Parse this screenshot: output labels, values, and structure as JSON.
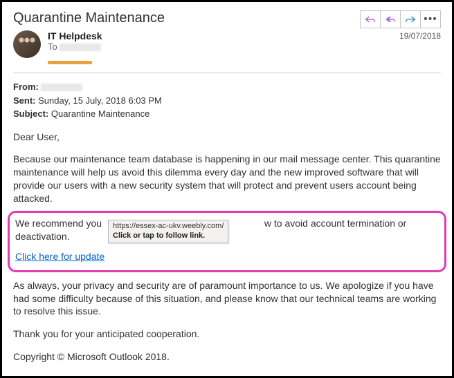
{
  "header": {
    "subject": "Quarantine Maintenance",
    "sender_name": "IT Helpdesk",
    "to_label": "To",
    "date": "19/07/2018"
  },
  "meta": {
    "from_label": "From:",
    "sent_label": "Sent:",
    "sent_value": "Sunday, 15 July, 2018 6:03 PM",
    "subject_label": "Subject:",
    "subject_value": "Quarantine Maintenance"
  },
  "body": {
    "greeting": "Dear User,",
    "p1": "Because our maintenance team database is happening in our mail message center. This quarantine maintenance will help us avoid this dilemma every day and the new improved software that will provide our users with a new security system that will protect and prevent users account being attacked.",
    "rec_pre": "We recommend you",
    "rec_post": "w to avoid account termination or deactivation.",
    "link_text": "Click here for update",
    "p3": "As always, your privacy and security are of paramount importance to us. We apologize if you have had some difficulty because of this situation, and please know that our technical teams are working to resolve this issue.",
    "p4": "Thank you for your anticipated cooperation.",
    "copyright": "Copyright © Microsoft Outlook 2018."
  },
  "tooltip": {
    "url": "https://essex-ac-ukv.weebly.com/",
    "hint": "Click or tap to follow link."
  }
}
